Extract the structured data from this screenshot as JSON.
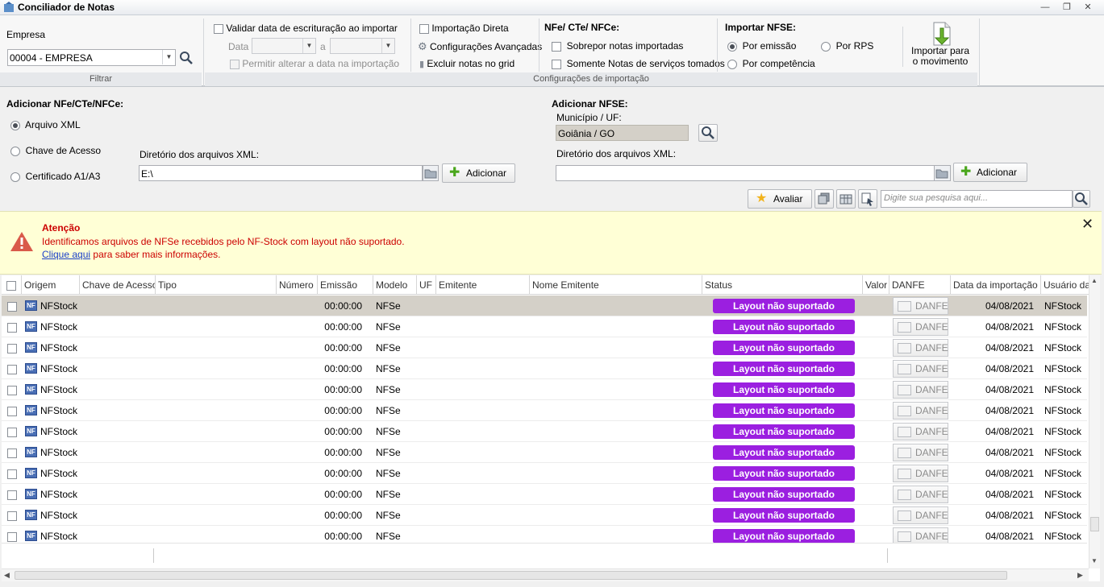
{
  "window": {
    "title": "Conciliador de Notas"
  },
  "filter": {
    "empresa_label": "Empresa",
    "empresa_value": "00004 - EMPRESA",
    "footer": "Filtrar"
  },
  "import_config": {
    "validar_data": "Validar data de escrituração ao importar",
    "data_label": "Data",
    "a_label": "a",
    "permitir_alterar": "Permitir alterar a data na importação",
    "importacao_direta": "Importação Direta",
    "config_avancadas": "Configurações Avançadas",
    "excluir_notas": "Excluir notas no grid",
    "nfe_header": "NFe/ CTe/ NFCe:",
    "sobrepor": "Sobrepor notas importadas",
    "somente_servicos": "Somente Notas de serviços tomados",
    "importar_nfse_header": "Importar NFSE:",
    "por_emissao": "Por emissão",
    "por_rps": "Por RPS",
    "por_competencia": "Por competência",
    "footer": "Configurações de importação"
  },
  "import_button": {
    "label_line1": "Importar para",
    "label_line2": "o movimento"
  },
  "add_nfe": {
    "title": "Adicionar NFe/CTe/NFCe:",
    "opt_xml": "Arquivo XML",
    "opt_chave": "Chave de Acesso",
    "opt_cert": "Certificado A1/A3",
    "dir_label": "Diretório dos arquivos XML:",
    "dir_value": "E:\\",
    "add_button": "Adicionar"
  },
  "add_nfse": {
    "title": "Adicionar NFSE:",
    "municipio_label": "Município / UF:",
    "municipio_value": "Goiânia / GO",
    "dir_label": "Diretório dos arquivos XML:",
    "dir_value": "",
    "add_button": "Adicionar"
  },
  "toolbar": {
    "avaliar": "Avaliar",
    "search_placeholder": "Digite sua pesquisa aqui..."
  },
  "alert": {
    "title": "Atenção",
    "message": "Identificamos arquivos de NFSe recebidos pelo NF-Stock com layout não suportado.",
    "link_text": "Clique aqui",
    "link_suffix": "para saber mais informações."
  },
  "grid": {
    "columns": [
      "Origem",
      "Chave de Acesso",
      "Tipo",
      "Número",
      "Emissão",
      "Modelo",
      "UF",
      "Emitente",
      "Nome Emitente",
      "Status",
      "Valor",
      "DANFE",
      "Data da importação",
      "Usuário da"
    ],
    "rows": [
      {
        "origem": "NFStock",
        "emissao": "00:00:00",
        "modelo": "NFSe",
        "status": "Layout não suportado",
        "danfe": "DANFE",
        "data_importacao": "04/08/2021",
        "usuario": "NFStock"
      },
      {
        "origem": "NFStock",
        "emissao": "00:00:00",
        "modelo": "NFSe",
        "status": "Layout não suportado",
        "danfe": "DANFE",
        "data_importacao": "04/08/2021",
        "usuario": "NFStock"
      },
      {
        "origem": "NFStock",
        "emissao": "00:00:00",
        "modelo": "NFSe",
        "status": "Layout não suportado",
        "danfe": "DANFE",
        "data_importacao": "04/08/2021",
        "usuario": "NFStock"
      },
      {
        "origem": "NFStock",
        "emissao": "00:00:00",
        "modelo": "NFSe",
        "status": "Layout não suportado",
        "danfe": "DANFE",
        "data_importacao": "04/08/2021",
        "usuario": "NFStock"
      },
      {
        "origem": "NFStock",
        "emissao": "00:00:00",
        "modelo": "NFSe",
        "status": "Layout não suportado",
        "danfe": "DANFE",
        "data_importacao": "04/08/2021",
        "usuario": "NFStock"
      },
      {
        "origem": "NFStock",
        "emissao": "00:00:00",
        "modelo": "NFSe",
        "status": "Layout não suportado",
        "danfe": "DANFE",
        "data_importacao": "04/08/2021",
        "usuario": "NFStock"
      },
      {
        "origem": "NFStock",
        "emissao": "00:00:00",
        "modelo": "NFSe",
        "status": "Layout não suportado",
        "danfe": "DANFE",
        "data_importacao": "04/08/2021",
        "usuario": "NFStock"
      },
      {
        "origem": "NFStock",
        "emissao": "00:00:00",
        "modelo": "NFSe",
        "status": "Layout não suportado",
        "danfe": "DANFE",
        "data_importacao": "04/08/2021",
        "usuario": "NFStock"
      },
      {
        "origem": "NFStock",
        "emissao": "00:00:00",
        "modelo": "NFSe",
        "status": "Layout não suportado",
        "danfe": "DANFE",
        "data_importacao": "04/08/2021",
        "usuario": "NFStock"
      },
      {
        "origem": "NFStock",
        "emissao": "00:00:00",
        "modelo": "NFSe",
        "status": "Layout não suportado",
        "danfe": "DANFE",
        "data_importacao": "04/08/2021",
        "usuario": "NFStock"
      },
      {
        "origem": "NFStock",
        "emissao": "00:00:00",
        "modelo": "NFSe",
        "status": "Layout não suportado",
        "danfe": "DANFE",
        "data_importacao": "04/08/2021",
        "usuario": "NFStock"
      },
      {
        "origem": "NFStock",
        "emissao": "00:00:00",
        "modelo": "NFSe",
        "status": "Layout não suportado",
        "danfe": "DANFE",
        "data_importacao": "04/08/2021",
        "usuario": "NFStock"
      }
    ]
  },
  "colors": {
    "status_badge": "#9b1fe0",
    "alert_bg": "#ffffd6",
    "alert_text": "#cc0000",
    "selected_row": "#d4d0c8"
  }
}
